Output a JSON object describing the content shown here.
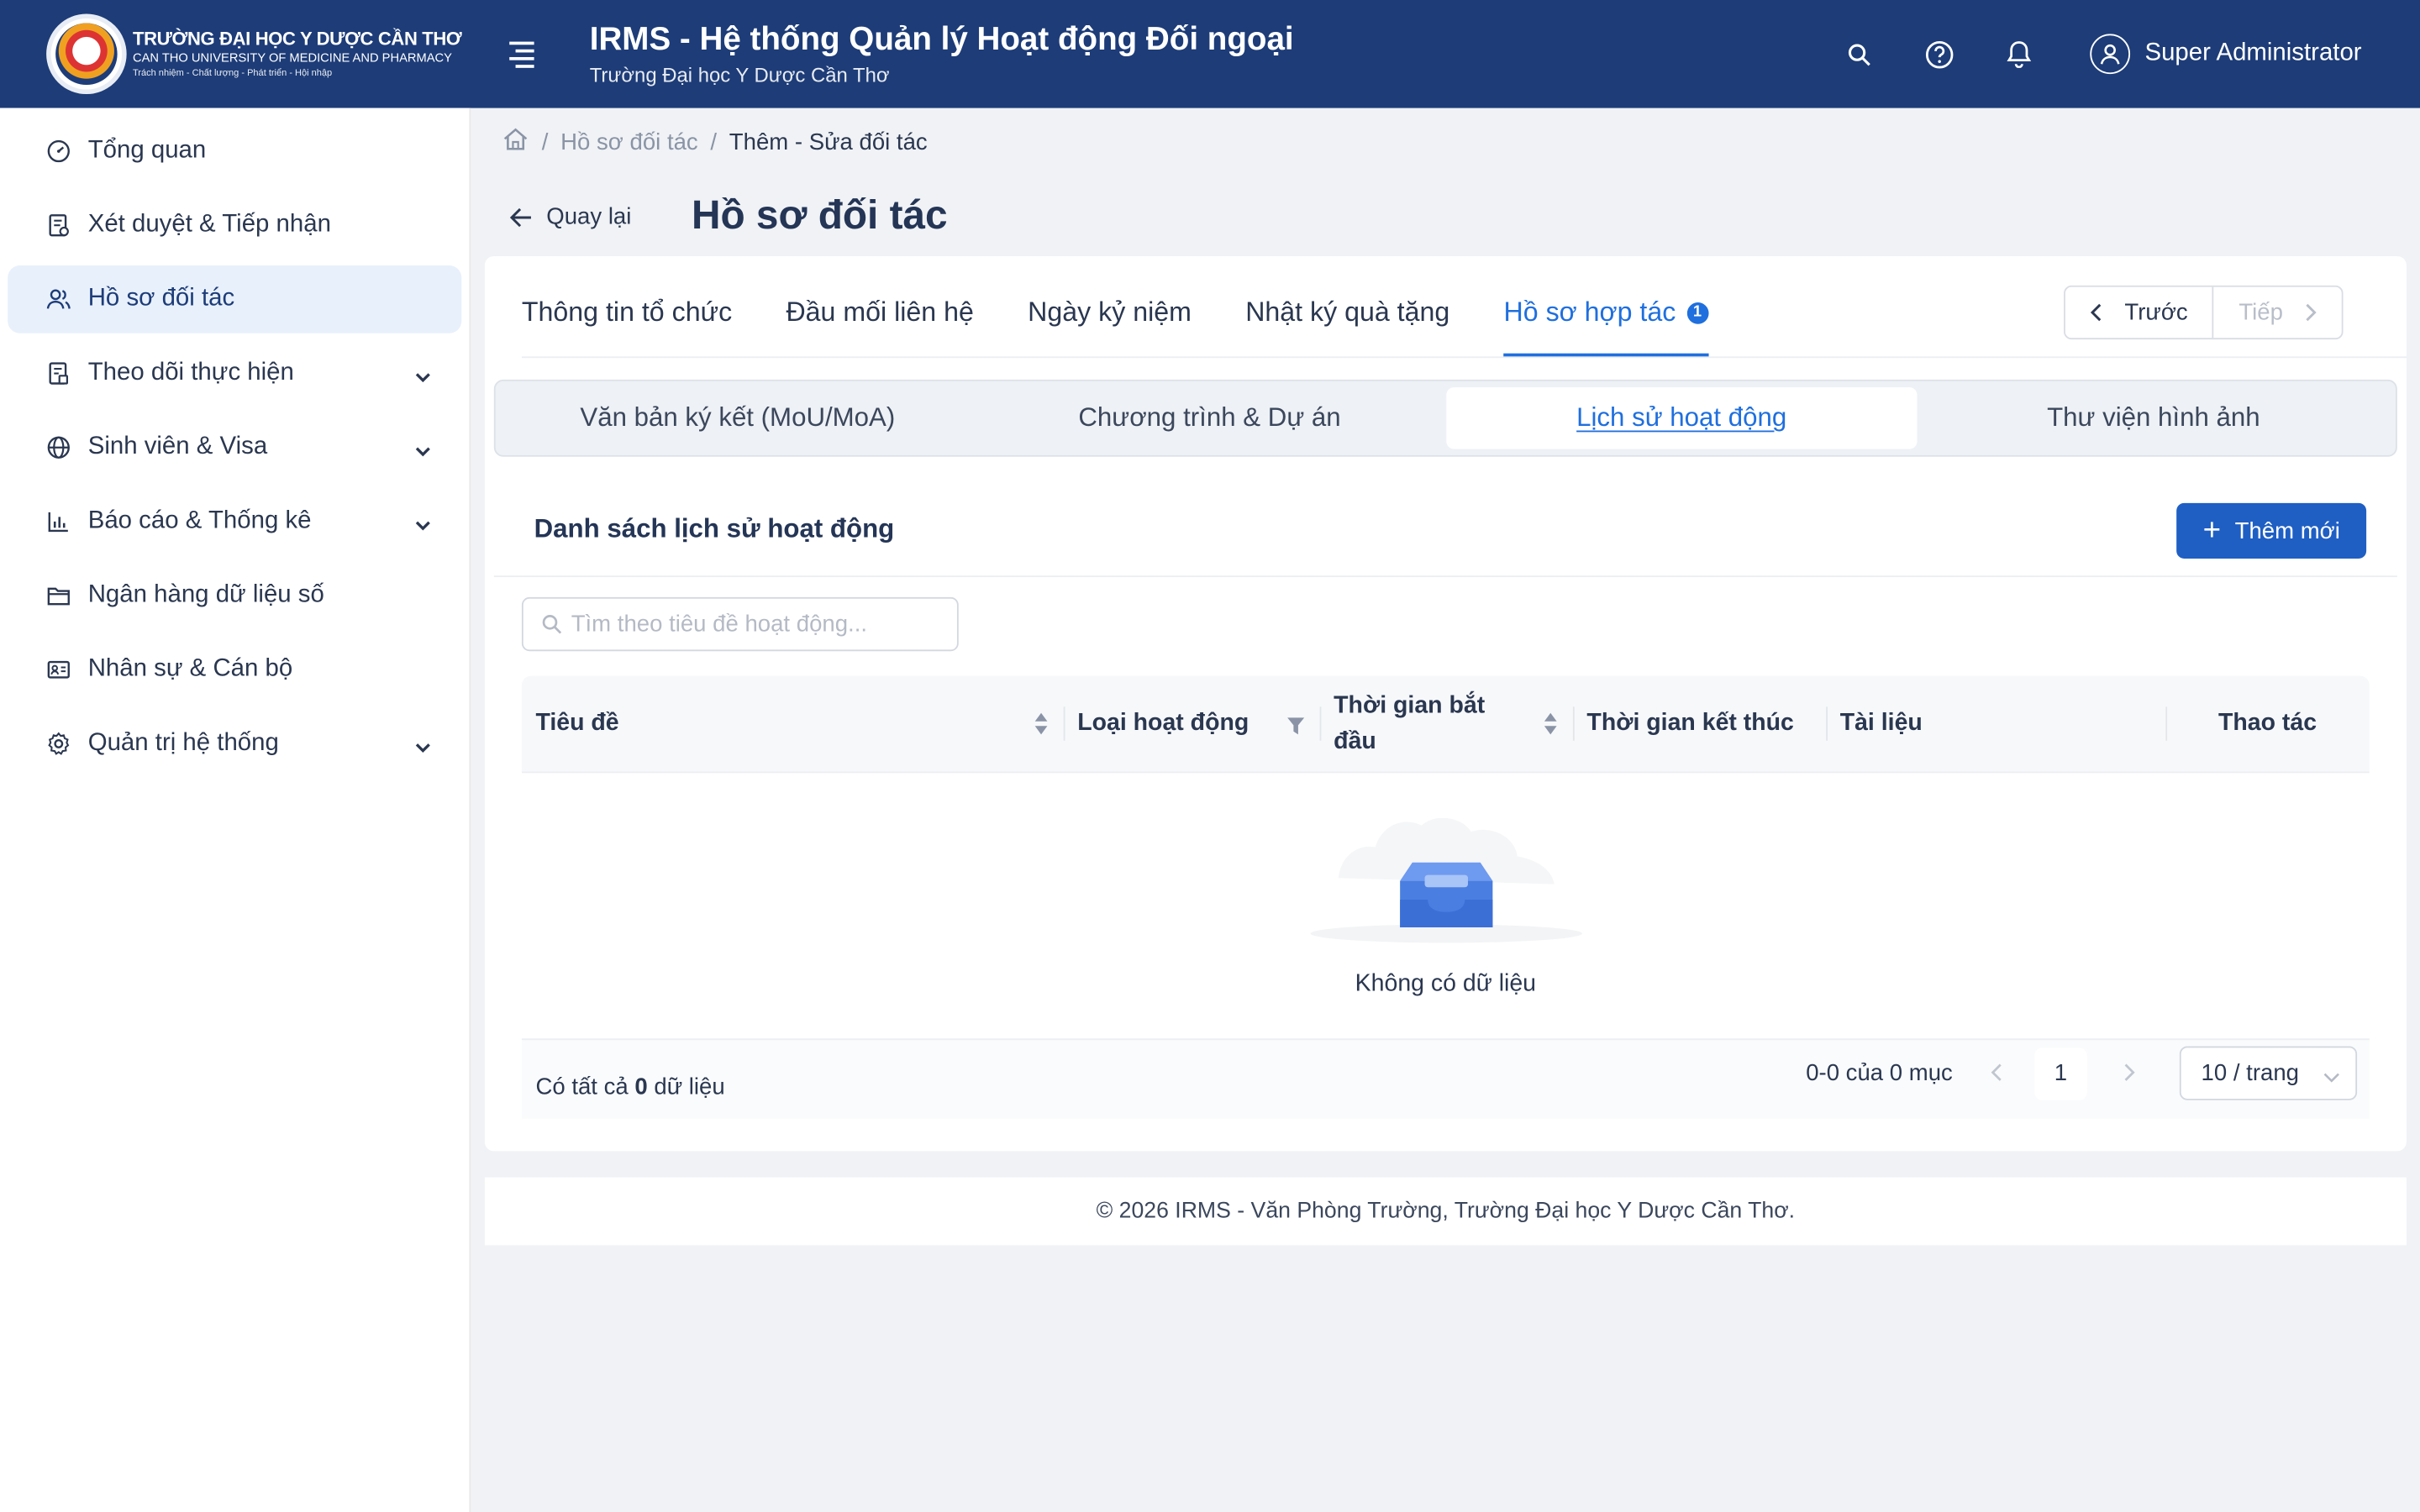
{
  "header": {
    "logo_line1": "TRƯỜNG ĐẠI HỌC Y DƯỢC CẦN THƠ",
    "logo_line2": "CAN THO UNIVERSITY OF MEDICINE AND PHARMACY",
    "logo_line3": "Trách nhiệm - Chất lượng - Phát triển - Hội nhập",
    "title": "IRMS - Hệ thống Quản lý Hoạt động Đối ngoại",
    "subtitle": "Trường Đại học Y Dược Cần Thơ",
    "user_name": "Super Administrator"
  },
  "sidebar": {
    "items": [
      {
        "label": "Tổng quan",
        "icon": "dashboard-icon"
      },
      {
        "label": "Xét duyệt & Tiếp nhận",
        "icon": "approval-icon"
      },
      {
        "label": "Hồ sơ đối tác",
        "icon": "partners-icon",
        "active": true
      },
      {
        "label": "Theo dõi thực hiện",
        "icon": "tracking-icon",
        "expandable": true
      },
      {
        "label": "Sinh viên & Visa",
        "icon": "globe-icon",
        "expandable": true
      },
      {
        "label": "Báo cáo & Thống kê",
        "icon": "chart-icon",
        "expandable": true
      },
      {
        "label": "Ngân hàng dữ liệu số",
        "icon": "folder-icon"
      },
      {
        "label": "Nhân sự & Cán bộ",
        "icon": "id-card-icon"
      },
      {
        "label": "Quản trị hệ thống",
        "icon": "gear-icon",
        "expandable": true
      }
    ]
  },
  "breadcrumb": {
    "items": [
      "Hồ sơ đối tác",
      "Thêm - Sửa đối tác"
    ]
  },
  "page": {
    "back_label": "Quay lại",
    "title": "Hồ sơ đối tác"
  },
  "tabs": {
    "items": [
      {
        "label": "Thông tin tổ chức"
      },
      {
        "label": "Đầu mối liên hệ"
      },
      {
        "label": "Ngày kỷ niệm"
      },
      {
        "label": "Nhật ký quà tặng"
      },
      {
        "label": "Hồ sơ hợp tác",
        "active": true,
        "badge": "1"
      }
    ],
    "prev_label": "Trước",
    "next_label": "Tiếp"
  },
  "subtabs": {
    "items": [
      {
        "label": "Văn bản ký kết (MoU/MoA)"
      },
      {
        "label": "Chương trình & Dự án"
      },
      {
        "label": "Lịch sử hoạt động",
        "active": true
      },
      {
        "label": "Thư viện hình ảnh"
      }
    ]
  },
  "list": {
    "title": "Danh sách lịch sử hoạt động",
    "add_label": "Thêm mới",
    "search_placeholder": "Tìm theo tiêu đề hoạt động...",
    "columns": [
      {
        "label": "Tiêu đề",
        "sortable": true
      },
      {
        "label": "Loại hoạt động",
        "filterable": true
      },
      {
        "label": "Thời gian bắt đầu",
        "sortable": true
      },
      {
        "label": "Thời gian kết thúc"
      },
      {
        "label": "Tài liệu"
      },
      {
        "label": "Thao tác"
      }
    ],
    "empty_text": "Không có dữ liệu",
    "total_prefix": "Có tất cả",
    "total_count": "0",
    "total_suffix": "dữ liệu",
    "range_text": "0-0 của 0 mục",
    "current_page": "1",
    "page_size": "10 / trang"
  },
  "footer": {
    "text": "© 2026 IRMS - Văn Phòng Trường, Trường Đại học Y Dược Cần Thơ."
  },
  "colors": {
    "header_bg": "#1d3c78",
    "accent": "#1f6fde",
    "primary_button": "#1f5fc4",
    "active_nav_bg": "#e8f0fb"
  }
}
